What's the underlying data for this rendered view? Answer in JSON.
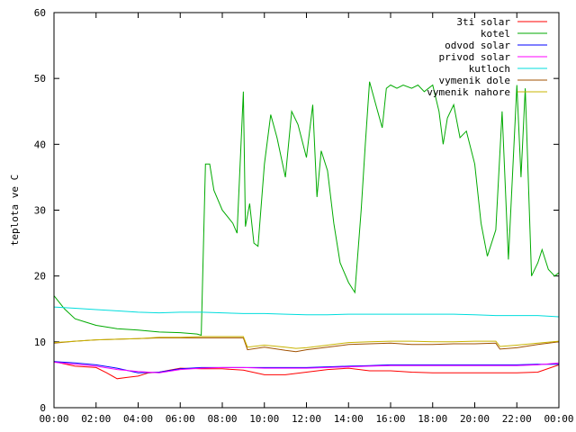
{
  "chart_data": {
    "type": "line",
    "title": "",
    "xlabel": "",
    "ylabel": "teplota ve C",
    "xlim": [
      0,
      24
    ],
    "ylim": [
      0,
      60
    ],
    "x_ticks": [
      "00:00",
      "02:00",
      "04:00",
      "06:00",
      "08:00",
      "10:00",
      "12:00",
      "14:00",
      "16:00",
      "18:00",
      "20:00",
      "22:00",
      "00:00"
    ],
    "y_ticks": [
      0,
      10,
      20,
      30,
      40,
      50,
      60
    ],
    "grid": false,
    "legend_position": "top-right",
    "series": [
      {
        "name": "3ti solar",
        "color": "#ff0000",
        "x": [
          0,
          1,
          2,
          2.5,
          3,
          3.5,
          4,
          4.5,
          5,
          5.5,
          6,
          7,
          8,
          9,
          10,
          11,
          12,
          13,
          14,
          15,
          16,
          17,
          18,
          19,
          20,
          21,
          22,
          23,
          24
        ],
        "y": [
          7.0,
          6.3,
          6.1,
          5.3,
          4.4,
          4.6,
          4.8,
          5.3,
          5.4,
          5.7,
          6.0,
          5.9,
          5.9,
          5.7,
          5.0,
          5.0,
          5.4,
          5.8,
          6.0,
          5.6,
          5.6,
          5.4,
          5.3,
          5.3,
          5.3,
          5.3,
          5.3,
          5.4,
          6.5
        ]
      },
      {
        "name": "kotel",
        "color": "#00aa00",
        "x": [
          0,
          0.5,
          1,
          1.5,
          2,
          3,
          4,
          5,
          6,
          6.8,
          7.0,
          7.2,
          7.4,
          7.6,
          8.0,
          8.5,
          8.7,
          9.0,
          9.1,
          9.3,
          9.5,
          9.7,
          10.0,
          10.3,
          10.6,
          11.0,
          11.3,
          11.6,
          12.0,
          12.3,
          12.5,
          12.7,
          13.0,
          13.3,
          13.6,
          14.0,
          14.3,
          14.6,
          14.8,
          15.0,
          15.3,
          15.6,
          15.8,
          16.0,
          16.3,
          16.6,
          17.0,
          17.3,
          17.6,
          18.0,
          18.3,
          18.5,
          18.7,
          19.0,
          19.3,
          19.6,
          20.0,
          20.3,
          20.6,
          21.0,
          21.3,
          21.6,
          22.0,
          22.2,
          22.4,
          22.7,
          23.0,
          23.2,
          23.5,
          23.8,
          24.0
        ],
        "y": [
          17.0,
          15.0,
          13.5,
          13.0,
          12.5,
          12.0,
          11.8,
          11.5,
          11.4,
          11.2,
          11.0,
          37.0,
          37.0,
          33.0,
          30.0,
          28.0,
          26.5,
          48.0,
          27.5,
          31.0,
          25.0,
          24.5,
          37.0,
          44.5,
          41.0,
          35.0,
          45.0,
          43.0,
          38.0,
          46.0,
          32.0,
          39.0,
          36.0,
          28.0,
          22.0,
          19.0,
          17.5,
          30.0,
          40.0,
          49.5,
          46.0,
          42.5,
          48.5,
          49.0,
          48.5,
          49.0,
          48.5,
          49.0,
          48.0,
          49.0,
          45.0,
          40.0,
          44.0,
          46.0,
          41.0,
          42.0,
          37.0,
          28.0,
          23.0,
          27.0,
          45.0,
          22.5,
          49.0,
          35.0,
          48.5,
          20.0,
          22.0,
          24.0,
          21.0,
          20.0,
          20.5
        ]
      },
      {
        "name": "odvod solar",
        "color": "#0000ff",
        "x": [
          0,
          1,
          2,
          3,
          4,
          5,
          6,
          7,
          8,
          9,
          10,
          11,
          12,
          13,
          14,
          15,
          16,
          17,
          18,
          19,
          20,
          21,
          22,
          23,
          24
        ],
        "y": [
          7.0,
          6.8,
          6.5,
          6.0,
          5.3,
          5.4,
          5.9,
          6.1,
          6.1,
          6.1,
          6.1,
          6.1,
          6.1,
          6.2,
          6.3,
          6.4,
          6.5,
          6.5,
          6.5,
          6.5,
          6.5,
          6.5,
          6.5,
          6.6,
          6.6
        ]
      },
      {
        "name": "privod solar",
        "color": "#ff00ff",
        "x": [
          0,
          1,
          2,
          3,
          4,
          5,
          6,
          7,
          8,
          9,
          10,
          11,
          12,
          13,
          14,
          15,
          16,
          17,
          18,
          19,
          20,
          21,
          22,
          23,
          24
        ],
        "y": [
          6.9,
          6.6,
          6.3,
          5.8,
          5.5,
          5.3,
          5.8,
          6.0,
          6.1,
          6.1,
          6.0,
          6.0,
          6.0,
          6.1,
          6.2,
          6.3,
          6.4,
          6.4,
          6.4,
          6.4,
          6.4,
          6.4,
          6.4,
          6.5,
          6.8
        ]
      },
      {
        "name": "kutloch",
        "color": "#00dddd",
        "x": [
          0,
          1,
          2,
          3,
          4,
          5,
          6,
          7,
          8,
          9,
          10,
          11,
          12,
          13,
          14,
          15,
          16,
          17,
          18,
          19,
          20,
          21,
          22,
          23,
          24
        ],
        "y": [
          15.3,
          15.1,
          14.9,
          14.7,
          14.5,
          14.4,
          14.5,
          14.5,
          14.4,
          14.3,
          14.3,
          14.2,
          14.1,
          14.1,
          14.2,
          14.2,
          14.2,
          14.2,
          14.2,
          14.2,
          14.1,
          14.0,
          14.0,
          14.0,
          13.8
        ]
      },
      {
        "name": "vymenik dole",
        "color": "#a05000",
        "x": [
          0,
          1,
          2,
          3,
          4,
          5,
          6,
          7,
          8,
          9,
          9.2,
          10,
          11,
          11.5,
          12,
          13,
          14,
          15,
          16,
          17,
          18,
          19,
          20,
          21,
          21.2,
          22,
          23,
          24
        ],
        "y": [
          9.8,
          10.1,
          10.3,
          10.4,
          10.5,
          10.6,
          10.6,
          10.6,
          10.6,
          10.6,
          8.8,
          9.2,
          8.7,
          8.5,
          8.8,
          9.2,
          9.6,
          9.7,
          9.8,
          9.6,
          9.6,
          9.7,
          9.7,
          9.8,
          8.9,
          9.1,
          9.6,
          10.0
        ]
      },
      {
        "name": "vymenik nahore",
        "color": "#c8b400",
        "x": [
          0,
          1,
          2,
          3,
          4,
          5,
          6,
          7,
          8,
          9,
          9.2,
          10,
          11,
          11.5,
          12,
          13,
          14,
          15,
          16,
          17,
          18,
          19,
          20,
          21,
          21.2,
          22,
          23,
          24
        ],
        "y": [
          9.9,
          10.1,
          10.3,
          10.4,
          10.5,
          10.7,
          10.7,
          10.8,
          10.8,
          10.8,
          9.2,
          9.5,
          9.2,
          9.0,
          9.1,
          9.5,
          9.9,
          10.0,
          10.1,
          10.1,
          10.0,
          10.0,
          10.1,
          10.1,
          9.3,
          9.5,
          9.8,
          10.1
        ]
      }
    ]
  }
}
